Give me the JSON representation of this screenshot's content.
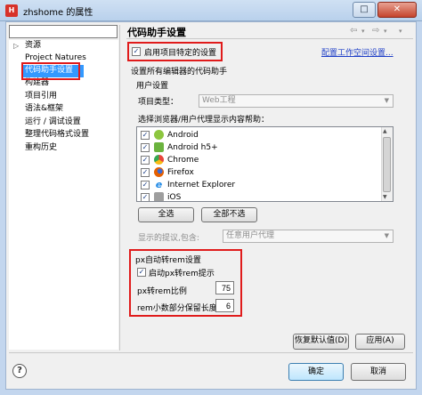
{
  "window": {
    "app_icon": "app-logo-icon",
    "title": "zhshome 的属性",
    "max_icon": "maximize-icon",
    "close_icon": "close-icon"
  },
  "nav": {
    "filter_value": "",
    "items": [
      {
        "label": "资源",
        "expandable": true
      },
      {
        "label": "Project Natures"
      },
      {
        "label": "代码助手设置",
        "selected": true
      },
      {
        "label": "构建器"
      },
      {
        "label": "项目引用"
      },
      {
        "label": "语法&框架"
      },
      {
        "label": "运行 / 调试设置"
      },
      {
        "label": "整理代码格式设置"
      },
      {
        "label": "重构历史"
      }
    ]
  },
  "page": {
    "title": "代码助手设置",
    "header_icons": [
      "back-arrow-icon",
      "back-dropdown-icon",
      "forward-arrow-icon",
      "forward-dropdown-icon",
      "view-menu-icon"
    ],
    "enable_project_specific": {
      "label": "启用项目特定的设置",
      "checked": true
    },
    "config_workspace_link": "配置工作空间设置...",
    "all_editors_label": "设置所有编辑器的代码助手",
    "user_settings_label": "用户设置",
    "project_type_label": "项目类型：",
    "project_type_value": "Web工程",
    "browser_prompt": "选择浏览器/用户代理显示内容帮助：",
    "browsers": [
      {
        "name": "Android",
        "checked": true,
        "color": "#8dc63f"
      },
      {
        "name": "Android h5+",
        "checked": true,
        "color": "#6bb33e"
      },
      {
        "name": "Chrome",
        "checked": true,
        "color": "#e8453c"
      },
      {
        "name": "Firefox",
        "checked": true,
        "color": "#e66000"
      },
      {
        "name": "Internet Explorer",
        "checked": true,
        "color": "#1e88e5"
      },
      {
        "name": "iOS",
        "checked": true,
        "color": "#9e9e9e"
      }
    ],
    "select_all_button": "全选",
    "deselect_all_button": "全部不选",
    "hint_label": "显示的提议,包含:",
    "hint_value": "任意用户代理",
    "px_settings_label": "px自动转rem设置",
    "px_rem_hint": {
      "label": "启动px转rem提示",
      "checked": true
    },
    "px_rem_ratio_label": "px转rem比例",
    "px_rem_ratio_value": "75",
    "decimal_places_label": "rem小数部分保留长度",
    "decimal_places_value": "6",
    "restore_defaults_button": "恢复默认值(D)",
    "apply_button": "应用(A)"
  },
  "footer": {
    "help_icon": "help-icon",
    "ok_button": "确定",
    "cancel_button": "取消"
  },
  "colors": {
    "selection": "#3399ff",
    "annotation_red": "#e01b1b",
    "link": "#1f3fc7"
  }
}
